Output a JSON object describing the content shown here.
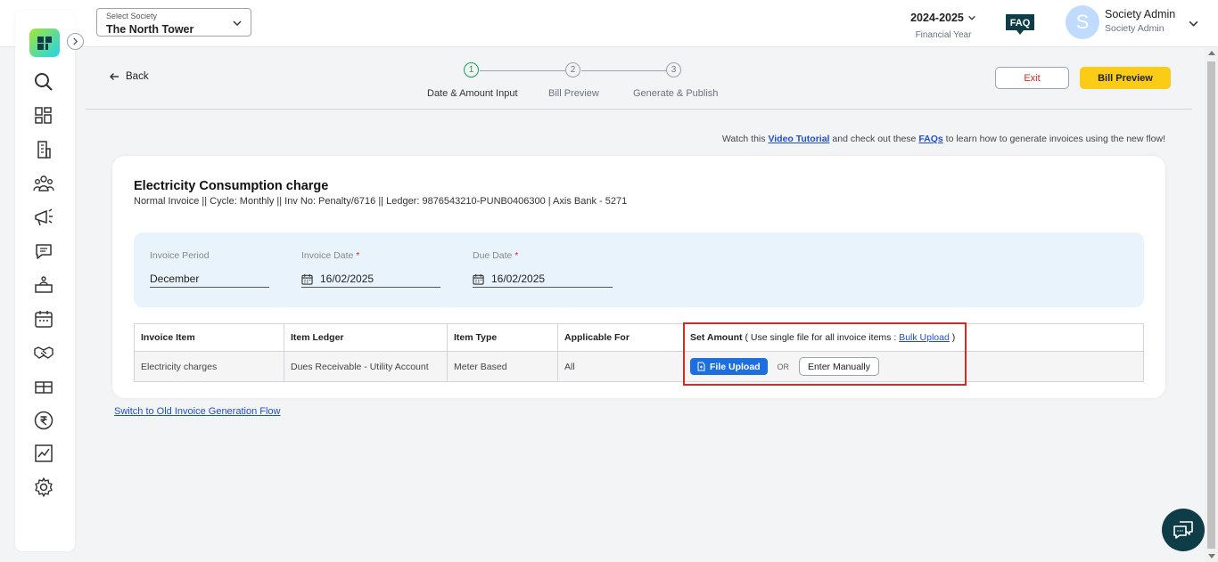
{
  "header": {
    "society_label": "Select Society",
    "society_value": "The North Tower",
    "financial_year": "2024-2025",
    "financial_year_label": "Financial Year",
    "faq_label": "FAQ",
    "avatar_letter": "S",
    "user_name": "Society Admin",
    "user_role": "Society Admin"
  },
  "sidebar": {
    "icons": [
      "search-icon",
      "dashboard-icon",
      "building-icon",
      "members-icon",
      "announcement-icon",
      "chat-icon",
      "reception-icon",
      "calendar-icon",
      "handshake-icon",
      "gift-icon",
      "rupee-icon",
      "report-chart-icon",
      "settings-icon"
    ]
  },
  "nav": {
    "back_label": "Back",
    "exit_label": "Exit",
    "bill_preview_label": "Bill Preview"
  },
  "stepper": {
    "steps": [
      {
        "number": "1",
        "label": "Date & Amount Input",
        "active": true
      },
      {
        "number": "2",
        "label": "Bill Preview",
        "active": false
      },
      {
        "number": "3",
        "label": "Generate & Publish",
        "active": false
      }
    ]
  },
  "help": {
    "prefix": "Watch this",
    "video_link": "Video Tutorial",
    "middle": "and check out these",
    "faq_link": "FAQs",
    "suffix": "to learn how to generate invoices using the new flow!"
  },
  "invoice": {
    "title": "Electricity Consumption charge",
    "subtitle": "Normal Invoice || Cycle: Monthly || Inv No: Penalty/6716 || Ledger: 9876543210-PUNB0406300 | Axis Bank - 5271",
    "period_label": "Invoice Period",
    "period_value": "December",
    "invoice_date_label": "Invoice Date",
    "invoice_date_value": "16/02/2025",
    "due_date_label": "Due Date",
    "due_date_value": "16/02/2025",
    "required_mark": "*"
  },
  "table": {
    "headers": {
      "item": "Invoice Item",
      "ledger": "Item Ledger",
      "type": "Item Type",
      "applicable": "Applicable For",
      "set_amount": "Set Amount",
      "set_amount_note": "( Use single file for all invoice items :",
      "bulk_upload": "Bulk Upload",
      "close_paren": ")"
    },
    "rows": [
      {
        "item": "Electricity charges",
        "ledger": "Dues Receivable - Utility Account",
        "type": "Meter Based",
        "applicable": "All",
        "file_upload_label": "File Upload",
        "or_label": "OR",
        "enter_manually_label": "Enter Manually"
      }
    ]
  },
  "footer": {
    "switch_link": "Switch to Old Invoice Generation Flow"
  },
  "colors": {
    "accent_yellow": "#facc15",
    "primary_blue": "#1d6fe0",
    "highlight_red": "#dc2626",
    "step_active_green": "#16a34a"
  }
}
